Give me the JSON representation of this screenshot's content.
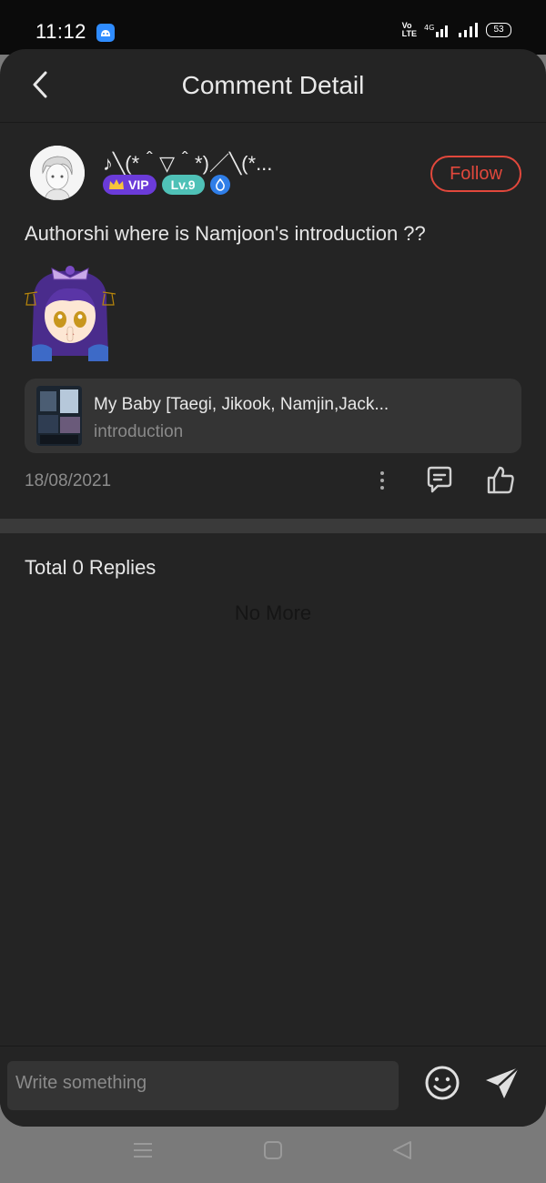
{
  "status": {
    "time": "11:12",
    "network": "4G",
    "volte": "Vo LTE",
    "battery": "53"
  },
  "header": {
    "title": "Comment Detail"
  },
  "comment": {
    "username": "♪╲(*＾▽＾*)／╲(*...",
    "vip_label": "VIP",
    "level_label": "Lv.9",
    "follow_label": "Follow",
    "text": "Authorshi where is Namjoon's introduction ??",
    "date": "18/08/2021",
    "book": {
      "title": "My Baby [Taegi, Jikook, Namjin,Jack...",
      "subtitle": "introduction"
    }
  },
  "replies": {
    "title": "Total 0 Replies",
    "empty_text": "No More"
  },
  "input": {
    "placeholder": "Write something"
  },
  "colors": {
    "accent": "#e2483c",
    "vip": "#6b3bd9",
    "level": "#4fc1b7",
    "background": "#242424"
  }
}
